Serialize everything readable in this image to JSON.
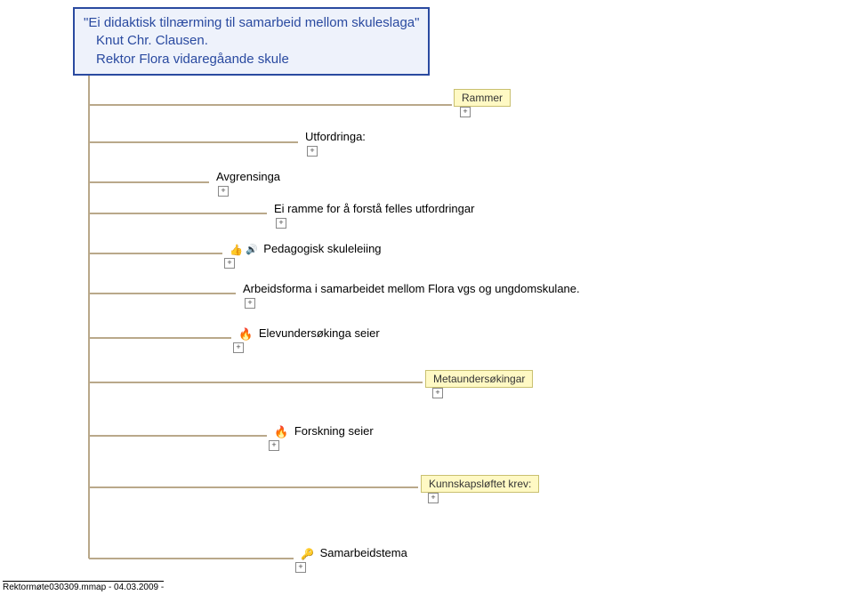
{
  "title": {
    "line1": "\"Ei didaktisk tilnærming til samarbeid mellom skuleslaga\"",
    "line2": "Knut Chr. Clausen.",
    "line3": "Rektor Flora vidaregåande skule"
  },
  "nodes": {
    "rammer": "Rammer",
    "utfordringa": "Utfordringa:",
    "avgrensinga": "Avgrensinga",
    "eiramme": "Ei ramme for å forstå felles utfordringar",
    "pedagogisk": "Pedagogisk skuleleiing",
    "arbeidsforma": "Arbeidsforma i samarbeidet mellom Flora vgs og ungdomskulane.",
    "elevund": "Elevundersøkinga seier",
    "metaund": "Metaundersøkingar",
    "forskning": "Forskning seier",
    "kunnskap": "Kunnskapsløftet krev:",
    "samarbeid": "Samarbeidstema"
  },
  "footer": "Rektormøte030309.mmap - 04.03.2009 -",
  "plus": "+"
}
